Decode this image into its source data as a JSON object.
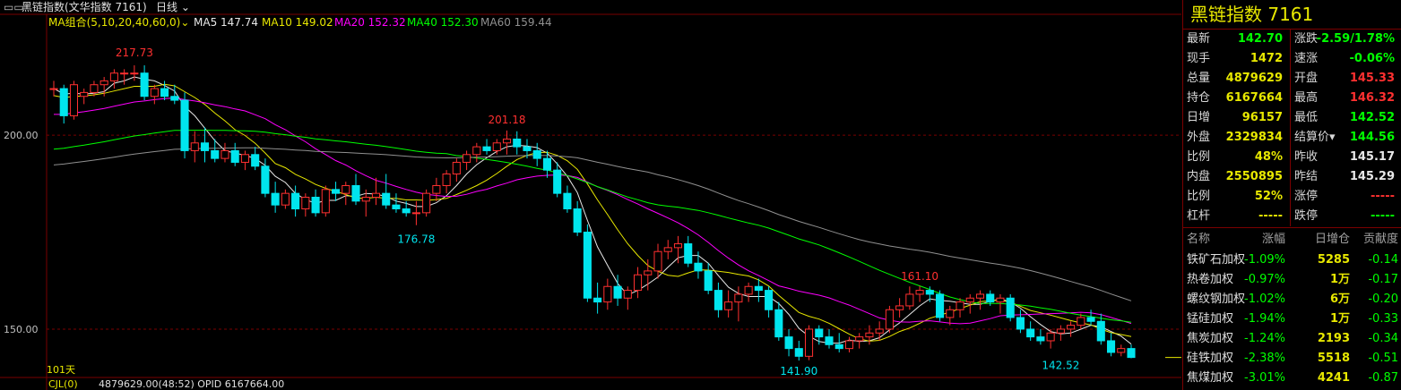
{
  "colors": {
    "up": "#ff3030",
    "down": "#00e5ee",
    "flat": "#e8e800",
    "ma5": "#e8e8e8",
    "ma10": "#e8e800",
    "ma20": "#ff00ff",
    "ma40": "#00ff00",
    "ma60": "#909090",
    "grid": "#7a0000"
  },
  "header": {
    "menu_icon": "menu-icon",
    "title": "黑链指数(文华指数 7161)",
    "period": "日线"
  },
  "ma": {
    "group": "MA组合(5,10,20,40,60,0)",
    "ma5": "MA5 147.74",
    "ma10": "MA10 149.02",
    "ma20": "MA20 152.32",
    "ma40": "MA40 152.30",
    "ma60": "MA60 159.44"
  },
  "bottom": {
    "cjl": "CJL(0)",
    "stats": "4879629.00(48:52)  OPID 6167664.00"
  },
  "chart_data": {
    "type": "candlestick",
    "count_label": "101天",
    "y_ticks": [
      200.0,
      150.0
    ],
    "y_tick_labels": [
      "200.00",
      "150.00"
    ],
    "ylim": [
      138,
      227
    ],
    "annotations": {
      "high1": "217.73",
      "high2": "201.18",
      "low1": "176.78",
      "high3": "161.10",
      "low2": "141.90",
      "low3": "142.52"
    },
    "candles": [
      [
        212,
        214,
        210,
        212
      ],
      [
        212,
        213,
        203,
        205
      ],
      [
        205,
        214,
        204,
        213
      ],
      [
        210,
        212,
        208,
        211
      ],
      [
        211,
        214,
        210,
        213
      ],
      [
        213,
        215,
        210,
        214
      ],
      [
        214,
        217,
        212,
        216
      ],
      [
        216,
        217,
        213,
        216
      ],
      [
        216,
        218,
        214,
        216
      ],
      [
        216,
        218,
        209,
        210
      ],
      [
        210,
        213,
        208,
        212
      ],
      [
        212,
        214,
        209,
        210
      ],
      [
        210,
        213,
        208,
        209
      ],
      [
        209,
        211,
        194,
        196
      ],
      [
        196,
        201,
        193,
        198
      ],
      [
        198,
        202,
        193,
        196
      ],
      [
        196,
        199,
        193,
        194
      ],
      [
        194,
        198,
        193,
        196
      ],
      [
        196,
        198,
        192,
        193
      ],
      [
        193,
        196,
        191,
        195
      ],
      [
        195,
        197,
        191,
        192
      ],
      [
        192,
        194,
        184,
        185
      ],
      [
        185,
        188,
        180,
        182
      ],
      [
        182,
        186,
        181,
        185
      ],
      [
        185,
        187,
        179,
        181
      ],
      [
        181,
        185,
        179,
        184
      ],
      [
        184,
        186,
        179,
        180
      ],
      [
        180,
        187,
        179,
        186
      ],
      [
        186,
        188,
        183,
        185
      ],
      [
        185,
        188,
        182,
        187
      ],
      [
        187,
        190,
        182,
        183
      ],
      [
        183,
        186,
        179,
        184
      ],
      [
        184,
        189,
        182,
        185
      ],
      [
        185,
        190,
        181,
        182
      ],
      [
        182,
        185,
        180,
        181
      ],
      [
        181,
        183,
        179,
        180
      ],
      [
        180,
        183,
        176.8,
        180
      ],
      [
        180,
        186,
        179,
        185
      ],
      [
        185,
        189,
        183,
        187
      ],
      [
        187,
        191,
        185,
        190
      ],
      [
        190,
        194,
        188,
        193
      ],
      [
        193,
        196,
        191,
        195
      ],
      [
        195,
        198,
        193,
        197
      ],
      [
        197,
        199,
        195,
        196
      ],
      [
        196,
        199,
        195,
        198
      ],
      [
        198,
        201.2,
        195,
        199
      ],
      [
        199,
        201,
        195,
        197
      ],
      [
        197,
        199,
        194,
        196
      ],
      [
        196,
        198,
        192,
        194
      ],
      [
        194,
        196,
        189,
        191
      ],
      [
        191,
        193,
        184,
        185
      ],
      [
        185,
        187,
        180,
        181
      ],
      [
        181,
        183,
        174,
        175
      ],
      [
        175,
        177,
        157,
        158
      ],
      [
        158,
        162,
        154,
        157
      ],
      [
        157,
        163,
        155,
        161
      ],
      [
        161,
        164,
        156,
        158
      ],
      [
        158,
        161,
        155,
        160
      ],
      [
        160,
        166,
        158,
        164
      ],
      [
        164,
        168,
        160,
        165
      ],
      [
        165,
        172,
        163,
        170
      ],
      [
        170,
        173,
        168,
        171
      ],
      [
        171,
        174,
        167,
        172
      ],
      [
        172,
        174,
        166,
        167
      ],
      [
        167,
        170,
        163,
        165
      ],
      [
        165,
        167,
        159,
        160
      ],
      [
        160,
        162,
        153,
        155
      ],
      [
        155,
        160,
        153,
        157
      ],
      [
        157,
        161,
        152,
        159
      ],
      [
        159,
        162,
        157,
        161
      ],
      [
        161,
        163,
        157,
        160
      ],
      [
        160,
        161,
        153,
        155
      ],
      [
        155,
        157,
        147,
        148
      ],
      [
        148,
        150,
        143,
        145
      ],
      [
        145,
        147,
        141.9,
        143
      ],
      [
        143,
        151,
        142,
        150
      ],
      [
        150,
        151,
        146,
        148
      ],
      [
        148,
        150,
        145,
        146
      ],
      [
        146,
        149,
        144,
        145
      ],
      [
        145,
        148,
        144,
        147
      ],
      [
        147,
        149,
        145,
        148
      ],
      [
        148,
        151,
        146,
        149
      ],
      [
        149,
        152,
        147,
        150
      ],
      [
        150,
        156,
        149,
        155
      ],
      [
        155,
        158,
        153,
        156
      ],
      [
        156,
        161,
        155,
        159
      ],
      [
        159,
        161.1,
        157,
        160
      ],
      [
        160,
        161,
        157,
        159
      ],
      [
        159,
        160,
        152,
        153
      ],
      [
        153,
        156,
        151,
        155
      ],
      [
        155,
        158,
        153,
        157
      ],
      [
        157,
        159,
        154,
        158
      ],
      [
        158,
        160,
        155,
        159
      ],
      [
        159,
        160,
        156,
        157
      ],
      [
        157,
        159,
        154,
        158
      ],
      [
        158,
        159,
        152,
        153
      ],
      [
        153,
        155,
        149,
        150
      ],
      [
        150,
        152,
        147,
        148
      ],
      [
        148,
        150,
        146,
        147
      ],
      [
        147,
        150,
        145,
        149
      ],
      [
        149,
        151,
        147,
        150
      ],
      [
        150,
        152,
        148,
        151
      ],
      [
        151,
        154,
        150,
        153
      ],
      [
        153,
        155,
        151,
        152
      ],
      [
        152,
        154,
        146,
        147
      ],
      [
        147,
        149,
        143,
        144
      ],
      [
        144,
        146,
        143,
        145
      ],
      [
        145,
        146,
        142.5,
        142.7
      ]
    ],
    "ma5_series": "computed",
    "note_ma": "moving averages shown for periods 5,10,20,40,60"
  },
  "panel": {
    "title": "黑链指数  7161",
    "quote": [
      {
        "label": "最新",
        "value": "142.70",
        "color": "#00ff00"
      },
      {
        "label": "涨跌",
        "value": "-2.59/1.78%",
        "color": "#00ff00"
      },
      {
        "label": "现手",
        "value": "1472",
        "color": "#e8e800"
      },
      {
        "label": "速涨",
        "value": "-0.06%",
        "color": "#00ff00"
      },
      {
        "label": "总量",
        "value": "4879629",
        "color": "#e8e800"
      },
      {
        "label": "开盘",
        "value": "145.33",
        "color": "#ff3030"
      },
      {
        "label": "持仓",
        "value": "6167664",
        "color": "#e8e800"
      },
      {
        "label": "最高",
        "value": "146.32",
        "color": "#ff3030"
      },
      {
        "label": "日增",
        "value": "96157",
        "color": "#e8e800"
      },
      {
        "label": "最低",
        "value": "142.52",
        "color": "#00ff00"
      },
      {
        "label": "外盘",
        "value": "2329834",
        "color": "#e8e800"
      },
      {
        "label": "结算价▾",
        "value": "144.56",
        "color": "#00ff00"
      },
      {
        "label": "比例",
        "value": "48%",
        "color": "#e8e800"
      },
      {
        "label": "昨收",
        "value": "145.17",
        "color": "#e8e8e8"
      },
      {
        "label": "内盘",
        "value": "2550895",
        "color": "#e8e800"
      },
      {
        "label": "昨结",
        "value": "145.29",
        "color": "#e8e8e8"
      },
      {
        "label": "比例",
        "value": "52%",
        "color": "#e8e800"
      },
      {
        "label": "涨停",
        "value": "-----",
        "color": "#ff3030"
      },
      {
        "label": "杠杆",
        "value": "-----",
        "color": "#e8e800"
      },
      {
        "label": "跌停",
        "value": "-----",
        "color": "#00ff00"
      }
    ],
    "comp_headers": {
      "name": "名称",
      "chg": "涨幅",
      "oi": "日增仓",
      "contrib": "贡献度"
    },
    "components": [
      {
        "name": "铁矿石加权",
        "chg": "-1.09%",
        "oi": "5285",
        "contrib": "-0.14"
      },
      {
        "name": "热卷加权",
        "chg": "-0.97%",
        "oi": "1万",
        "contrib": "-0.17"
      },
      {
        "name": "螺纹钢加权",
        "chg": "-1.02%",
        "oi": "6万",
        "contrib": "-0.20"
      },
      {
        "name": "锰硅加权",
        "chg": "-1.94%",
        "oi": "1万",
        "contrib": "-0.33"
      },
      {
        "name": "焦炭加权",
        "chg": "-1.24%",
        "oi": "2193",
        "contrib": "-0.34"
      },
      {
        "name": "硅铁加权",
        "chg": "-2.38%",
        "oi": "5518",
        "contrib": "-0.51"
      },
      {
        "name": "焦煤加权",
        "chg": "-3.01%",
        "oi": "4241",
        "contrib": "-0.87"
      }
    ]
  }
}
